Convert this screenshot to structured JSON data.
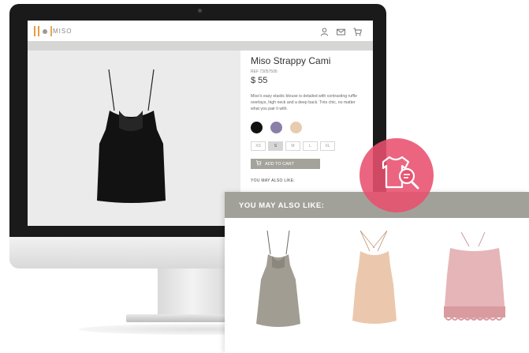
{
  "store": {
    "logo_text": "MISO"
  },
  "product": {
    "title": "Miso Strappy Cami",
    "ref": "REF 73057506",
    "price": "$ 55",
    "description": "Miso's easy elastic blouse is detailed with contrasting ruffle overlays, high neck and a deep back. Très chic, no matter what you pair it with.",
    "colors": [
      "#111111",
      "#8a7fa8",
      "#e8cbb0"
    ],
    "sizes": [
      "XS",
      "S",
      "M",
      "L",
      "XL"
    ],
    "selected_size": "S",
    "add_to_cart": "ADD TO CART",
    "also_like_label": "YOU MAY ALSO LIKE:"
  },
  "recommendations": {
    "title": "YOU MAY ALSO LIKE:",
    "items": [
      {
        "color": "#a29d92"
      },
      {
        "color": "#ebc8ad"
      },
      {
        "color": "#e6b5b8"
      }
    ]
  },
  "colors": {
    "accent": "#e8506e",
    "header_bar": "#a2a199",
    "logo_orange": "#e59b40"
  },
  "icons": [
    "user-icon",
    "mail-icon",
    "cart-icon",
    "tshirt-search-icon"
  ]
}
